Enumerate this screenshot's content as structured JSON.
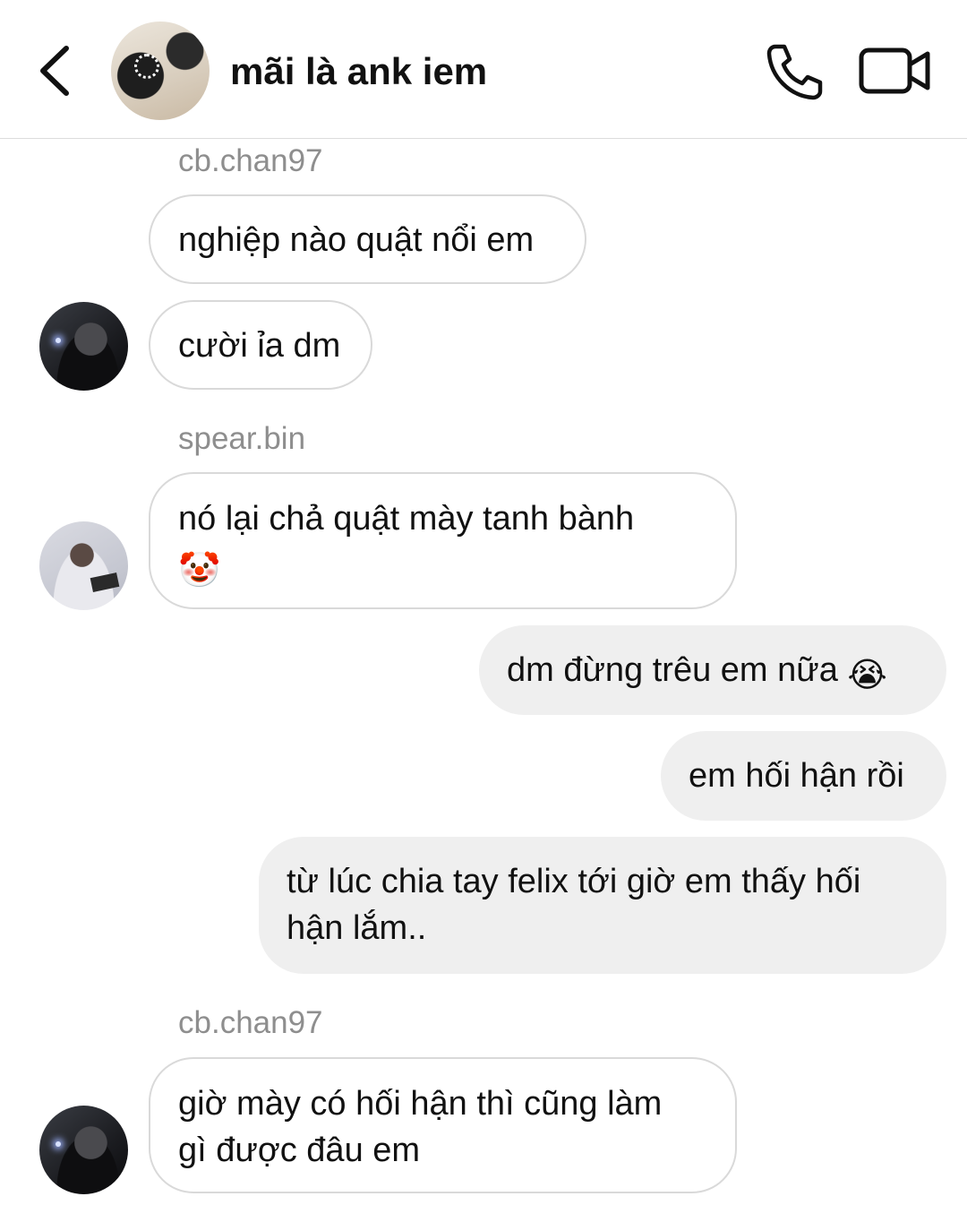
{
  "header": {
    "title": "mãi là ank iem",
    "back_icon": "chevron-left-icon",
    "call_icon": "phone-icon",
    "video_icon": "video-camera-icon"
  },
  "messages": [
    {
      "sender": "cb.chan97",
      "direction": "incoming",
      "text": "nghiệp nào quật nổi em"
    },
    {
      "direction": "incoming",
      "text": "cười ỉa dm"
    },
    {
      "sender": "spear.bin",
      "direction": "incoming",
      "text": "nó lại chả quật mày tanh bành",
      "emoji": "🤡"
    },
    {
      "direction": "outgoing",
      "text": "dm đừng trêu em nữa",
      "emoji": "😭"
    },
    {
      "direction": "outgoing",
      "text": "em hối hận rồi"
    },
    {
      "direction": "outgoing",
      "text_line1": "từ lúc chia tay felix tới giờ em thấy hối",
      "text_line2": "hận lắm.."
    },
    {
      "sender": "cb.chan97",
      "direction": "incoming",
      "text_line1": "giờ mày có hối hận thì cũng làm",
      "text_line2": "gì được đâu em"
    }
  ],
  "colors": {
    "incoming_bubble_border": "#d9d9d9",
    "outgoing_bubble_bg": "#efefef",
    "sender_name": "#8e8e8e"
  }
}
